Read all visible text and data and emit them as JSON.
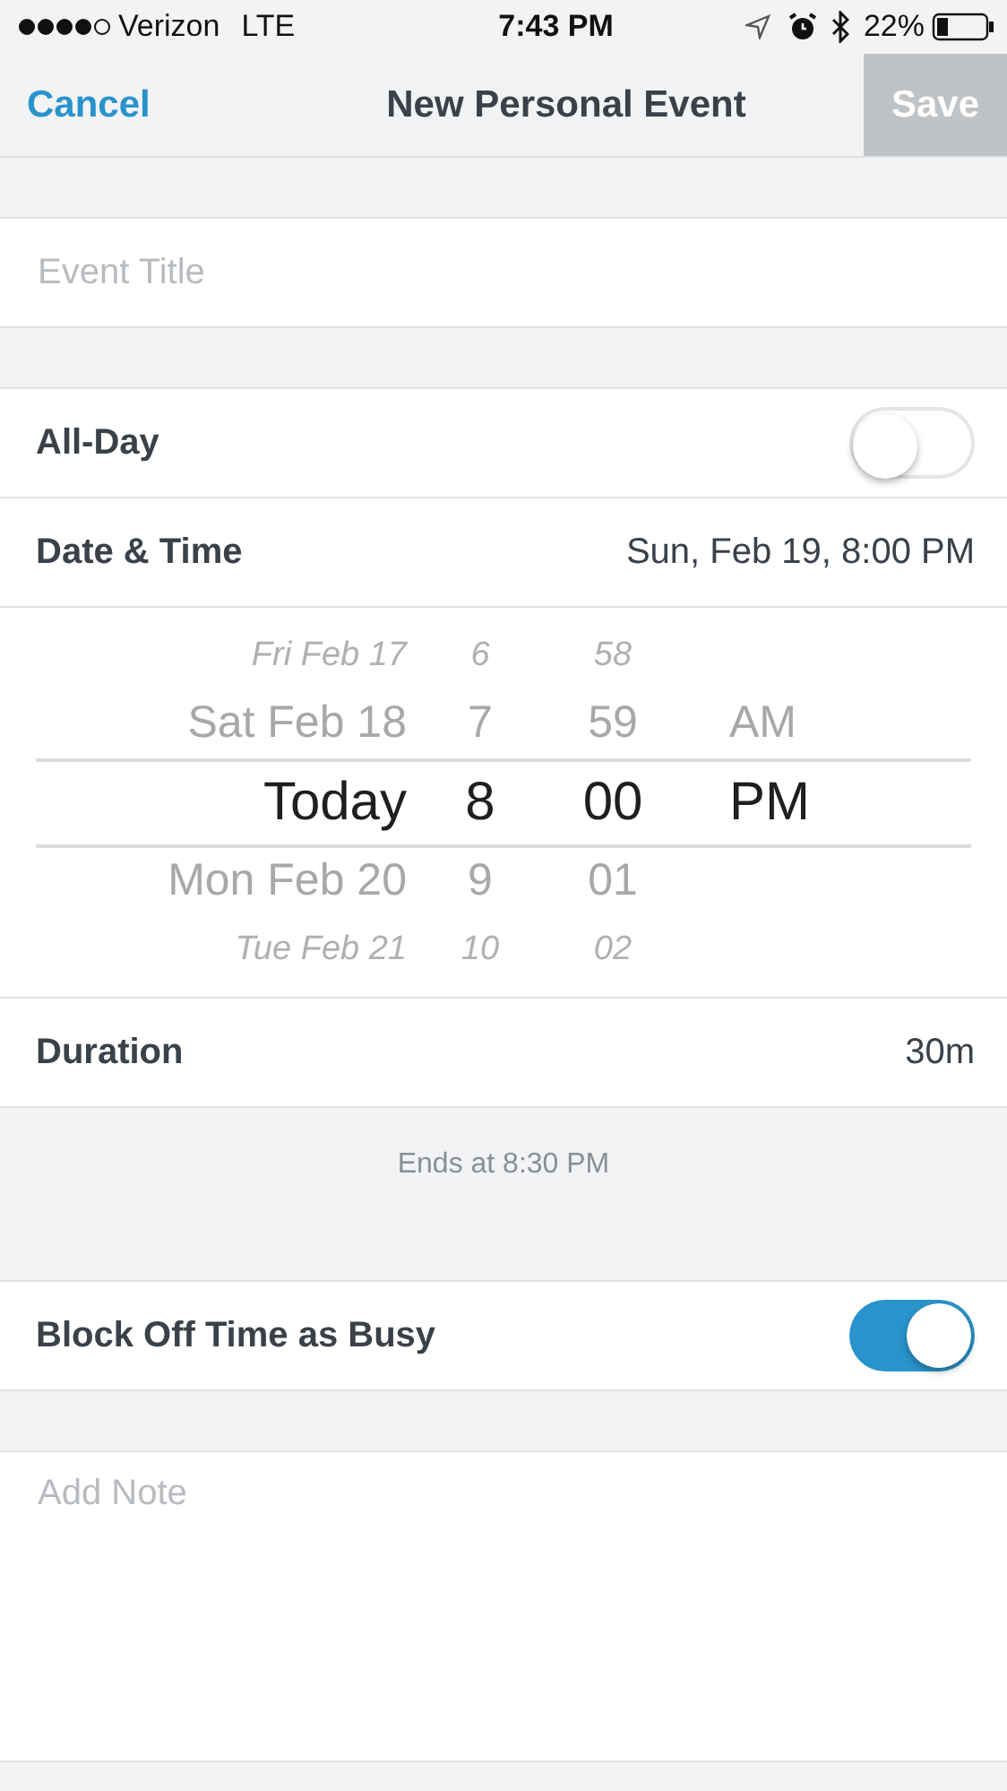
{
  "status_bar": {
    "carrier": "Verizon",
    "network": "LTE",
    "time": "7:43 PM",
    "battery": "22%"
  },
  "nav": {
    "cancel": "Cancel",
    "title": "New Personal Event",
    "save": "Save",
    "save_disabled": true
  },
  "event_title": {
    "placeholder": "Event Title"
  },
  "all_day": {
    "label": "All-Day",
    "on": false
  },
  "date_time": {
    "label": "Date & Time",
    "value": "Sun, Feb 19, 8:00 PM"
  },
  "picker": {
    "rows": [
      {
        "date": "Fri Feb 17",
        "hour": "6",
        "minute": "58",
        "selected": false
      },
      {
        "date": "Sat Feb 18",
        "hour": "7",
        "minute": "59",
        "period": "AM",
        "selected": false
      },
      {
        "date": "Today",
        "hour": "8",
        "minute": "00",
        "period": "PM",
        "selected": true
      },
      {
        "date": "Mon Feb 20",
        "hour": "9",
        "minute": "01",
        "selected": false
      },
      {
        "date": "Tue Feb 21",
        "hour": "10",
        "minute": "02",
        "selected": false
      }
    ]
  },
  "duration": {
    "label": "Duration",
    "value": "30m"
  },
  "ends_at": "Ends at 8:30 PM",
  "block_busy": {
    "label": "Block Off Time as Busy",
    "on": true
  },
  "note": {
    "placeholder": "Add Note"
  }
}
